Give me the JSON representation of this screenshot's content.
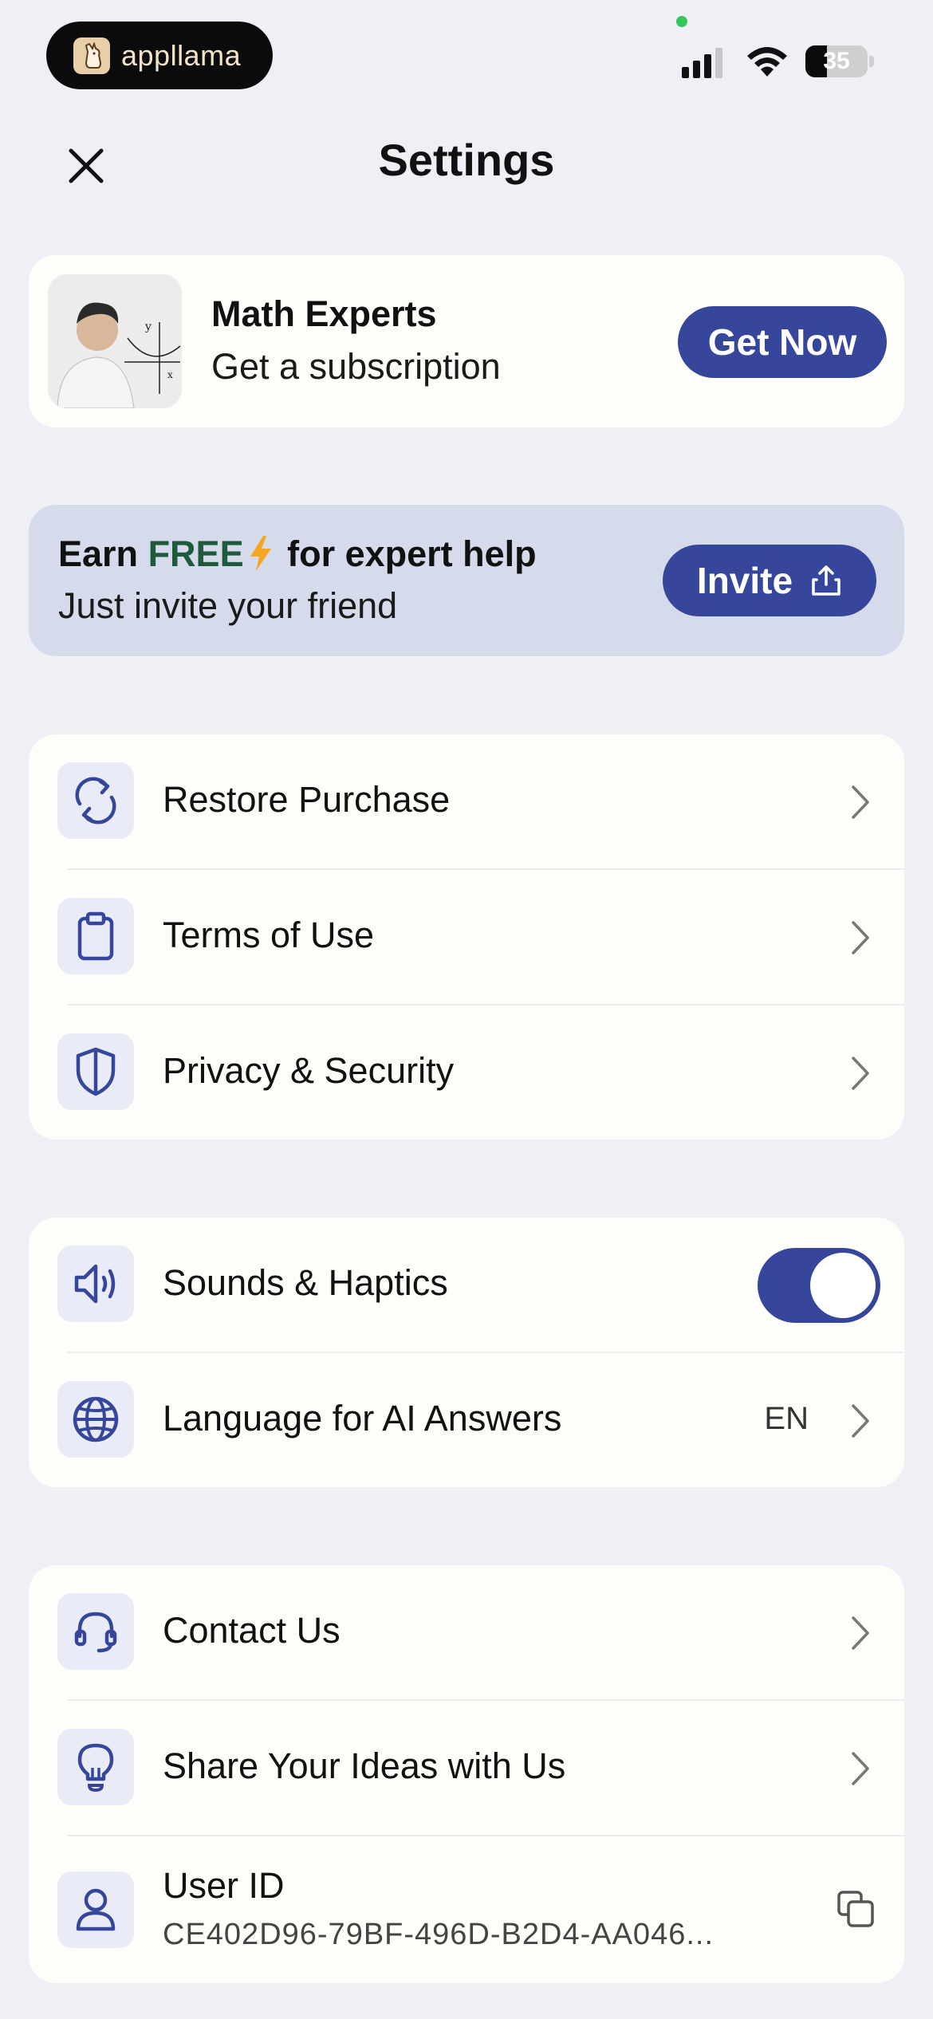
{
  "status_bar": {
    "brand": "appllama",
    "battery": "35"
  },
  "header": {
    "title": "Settings"
  },
  "subscription": {
    "title": "Math Experts",
    "subtitle": "Get a subscription",
    "button": "Get Now"
  },
  "invite": {
    "title_earn": "Earn",
    "title_free": "FREE",
    "title_rest": "for expert help",
    "subtitle": "Just invite your friend",
    "button": "Invite"
  },
  "group1": [
    {
      "label": "Restore Purchase",
      "icon": "restore-icon"
    },
    {
      "label": "Terms of Use",
      "icon": "clipboard-icon"
    },
    {
      "label": "Privacy & Security",
      "icon": "shield-icon"
    }
  ],
  "group2": {
    "sounds": {
      "label": "Sounds & Haptics",
      "icon": "speaker-icon",
      "enabled": true
    },
    "language": {
      "label": "Language for AI Answers",
      "icon": "globe-icon",
      "value": "EN"
    }
  },
  "group3": {
    "contact": {
      "label": "Contact Us",
      "icon": "headset-icon"
    },
    "ideas": {
      "label": "Share Your Ideas with Us",
      "icon": "lightbulb-icon"
    },
    "user": {
      "label": "User ID",
      "value": "CE402D96-79BF-496D-B2D4-AA046...",
      "icon": "user-icon"
    }
  },
  "colors": {
    "accent": "#36479b",
    "background": "#eff0f6",
    "card": "#fdfdf9",
    "invite_card": "#d5dbea",
    "free_text": "#1f5a3c",
    "bolt": "#f5a623"
  }
}
